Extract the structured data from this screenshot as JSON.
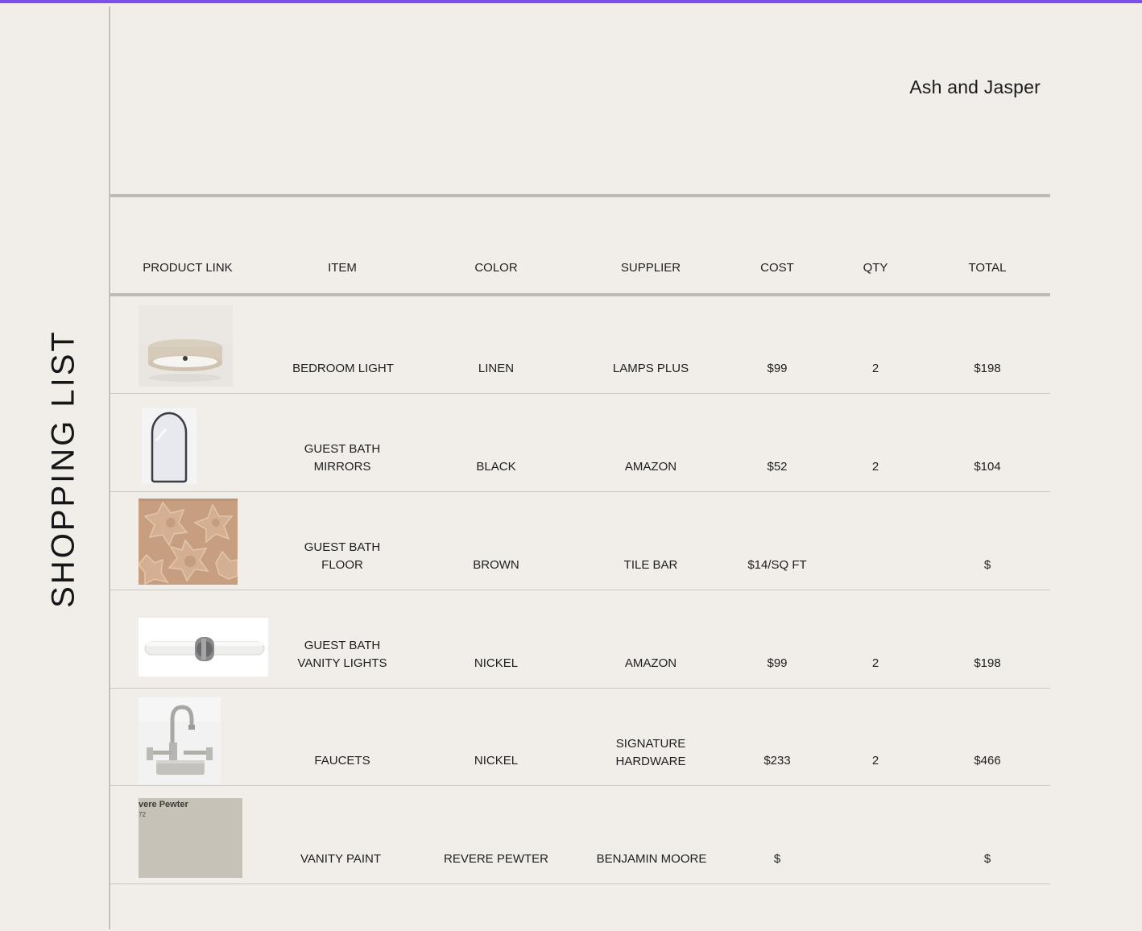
{
  "sidebar": {
    "title": "SHOPPING LIST"
  },
  "brand": {
    "name": "Ash and Jasper"
  },
  "table": {
    "headers": [
      "PRODUCT LINK",
      "ITEM",
      "COLOR",
      "SUPPLIER",
      "COST",
      "QTY",
      "TOTAL"
    ],
    "rows": [
      {
        "image": "ceiling-light-image",
        "item": "BEDROOM LIGHT",
        "color": "LINEN",
        "supplier": "LAMPS PLUS",
        "cost": "$99",
        "qty": "2",
        "total": "$198"
      },
      {
        "image": "arched-mirror-image",
        "item": "GUEST BATH\nMIRRORS",
        "color": "BLACK",
        "supplier": "AMAZON",
        "cost": "$52",
        "qty": "2",
        "total": "$104"
      },
      {
        "image": "tile-image",
        "item": "GUEST BATH\nFLOOR",
        "color": "BROWN",
        "supplier": "TILE BAR",
        "cost": "$14/SQ FT",
        "qty": "",
        "total": "$"
      },
      {
        "image": "vanity-light-image",
        "item": "GUEST BATH\nVANITY LIGHTS",
        "color": "NICKEL",
        "supplier": "AMAZON",
        "cost": "$99",
        "qty": "2",
        "total": "$198"
      },
      {
        "image": "faucet-image",
        "item": "FAUCETS",
        "color": "NICKEL",
        "supplier": "SIGNATURE\nHARDWARE",
        "cost": "$233",
        "qty": "2",
        "total": "$466"
      },
      {
        "image": "paint-swatch-image",
        "item": "VANITY PAINT",
        "color": "REVERE PEWTER",
        "supplier": "BENJAMIN MOORE",
        "cost": "$",
        "qty": "",
        "total": "$"
      }
    ],
    "swatch_text": {
      "name": "vere Pewter",
      "code": "72"
    }
  }
}
